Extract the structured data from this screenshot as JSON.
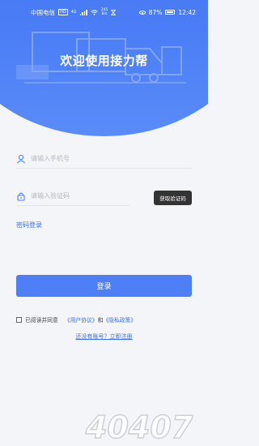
{
  "status_bar": {
    "carrier": "中国电信",
    "hd": "HD",
    "network": "4G",
    "speed_value": "245",
    "speed_unit": "B/s",
    "battery_percent": "87%",
    "time": "12:42"
  },
  "header": {
    "title": "欢迎使用接力帮",
    "accent_color": "#4a7cf5"
  },
  "form": {
    "phone_placeholder": "请输入手机号",
    "code_placeholder": "请输入验证码",
    "get_code_label": "获取验证码",
    "password_login_label": "密码登录",
    "login_label": "登录"
  },
  "agreement": {
    "prefix": "已阅读并同意",
    "user_agreement": "《用户协议》",
    "and": "和",
    "privacy_policy": "《隐私政策》"
  },
  "register": {
    "label": "还没有账号？立即注册"
  },
  "watermark": {
    "text": "40407"
  }
}
